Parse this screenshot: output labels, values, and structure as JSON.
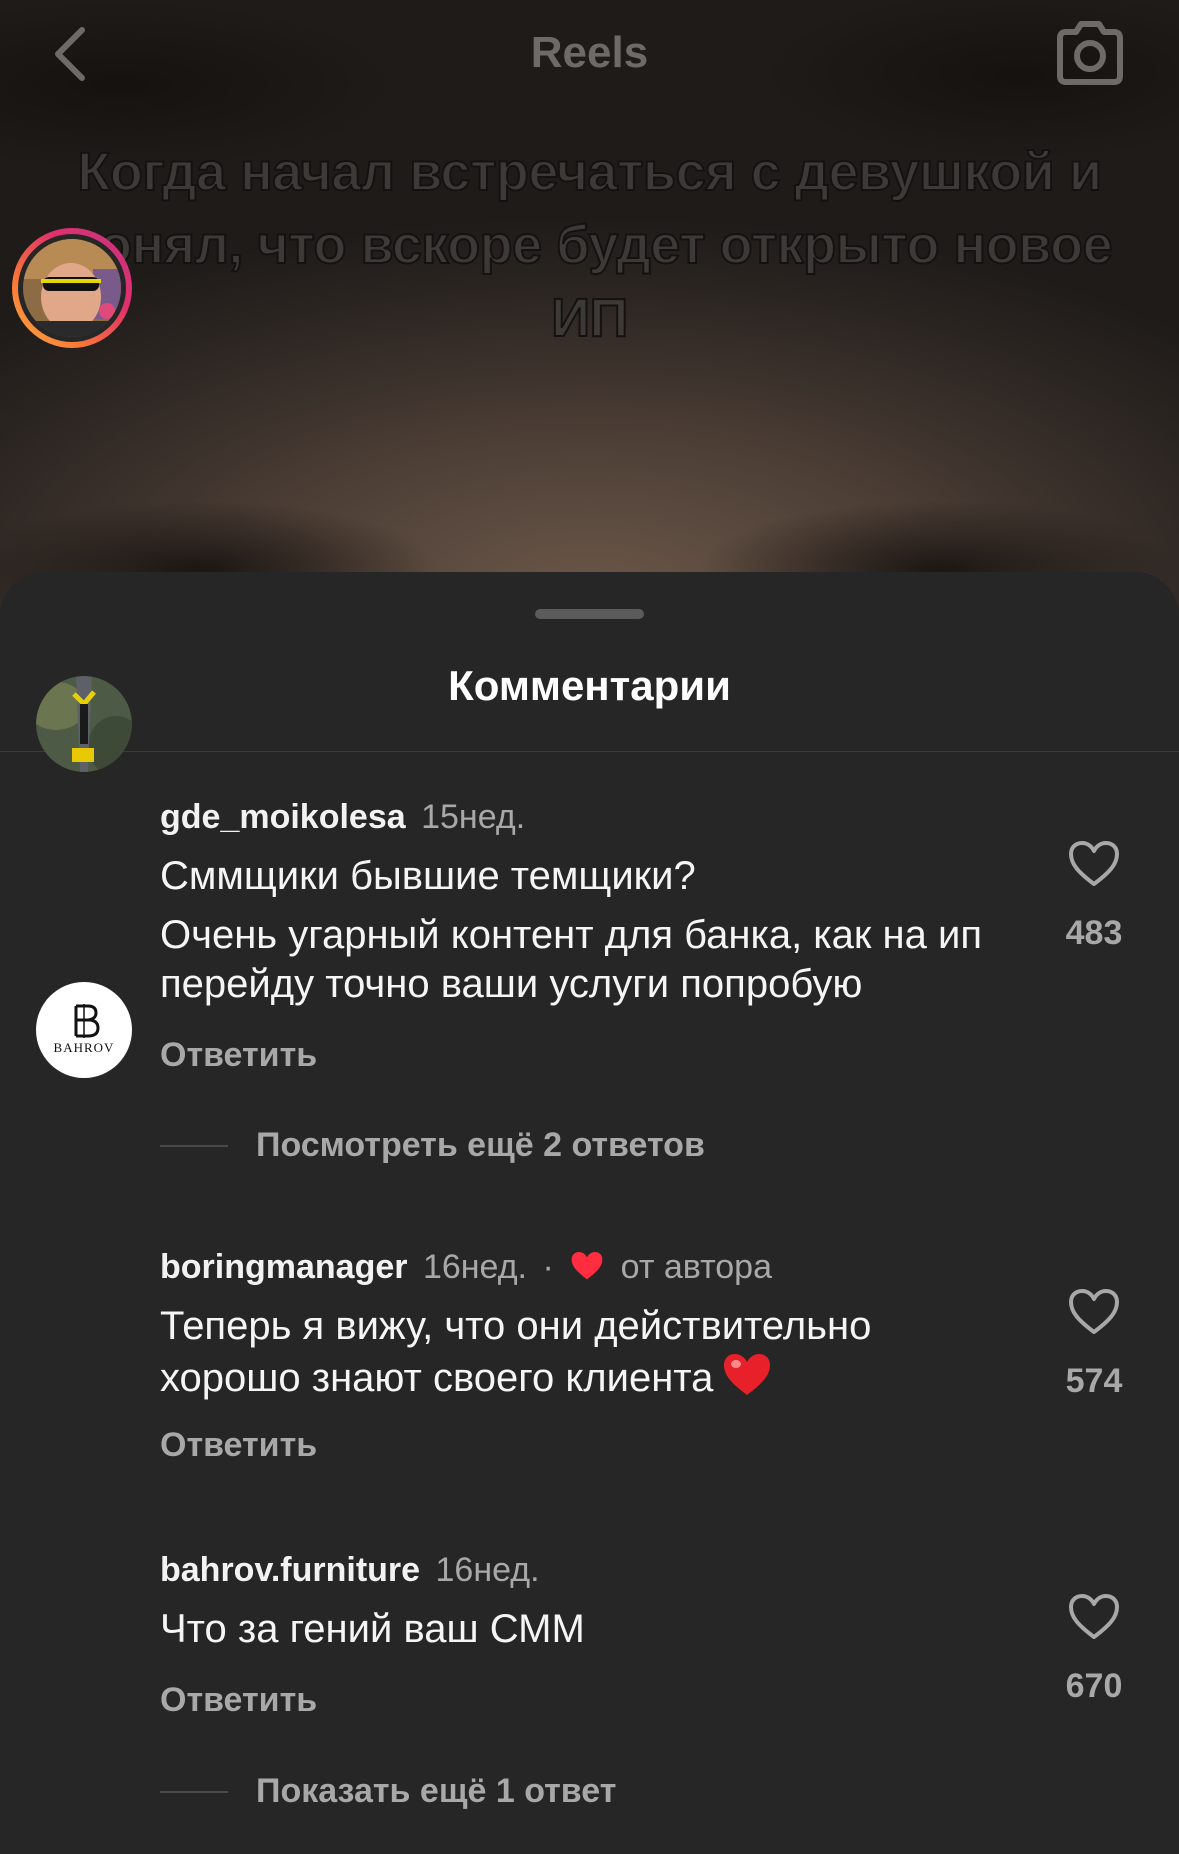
{
  "header": {
    "title": "Reels",
    "back_icon": "chevron-left-icon",
    "camera_icon": "camera-icon"
  },
  "video": {
    "caption": "Когда начал встречаться с девушкой и понял, что вскоре будет открыто новое ИП"
  },
  "comments_sheet": {
    "title": "Комментарии",
    "comments": [
      {
        "username": "gde_moikolesa",
        "time": "15нед.",
        "text_lines": [
          "Сммщики бывшие темщики?",
          "Очень угарный контент для банка, как на ип перейду точно ваши услуги попробую"
        ],
        "reply_label": "Ответить",
        "likes": "483",
        "more_replies": "Посмотреть ещё 2 ответов",
        "has_story_ring": true
      },
      {
        "username": "boringmanager",
        "time": "16нед.",
        "separator": "·",
        "author_badge": "от автора",
        "text": "Теперь я вижу, что они действительно хорошо знают своего клиента",
        "reply_label": "Ответить",
        "likes": "574"
      },
      {
        "username": "bahrov.furniture",
        "time": "16нед.",
        "text": "Что за гений ваш СММ",
        "reply_label": "Ответить",
        "likes": "670",
        "avatar_logo": "BAHROV",
        "more_replies": "Показать ещё 1 ответ"
      }
    ]
  },
  "colors": {
    "sheet_bg": "#262626",
    "secondary_text": "#a8a8a8",
    "heart_red": "#ff2d3f",
    "ring_start": "#fcaf45",
    "ring_end": "#e1306c"
  }
}
